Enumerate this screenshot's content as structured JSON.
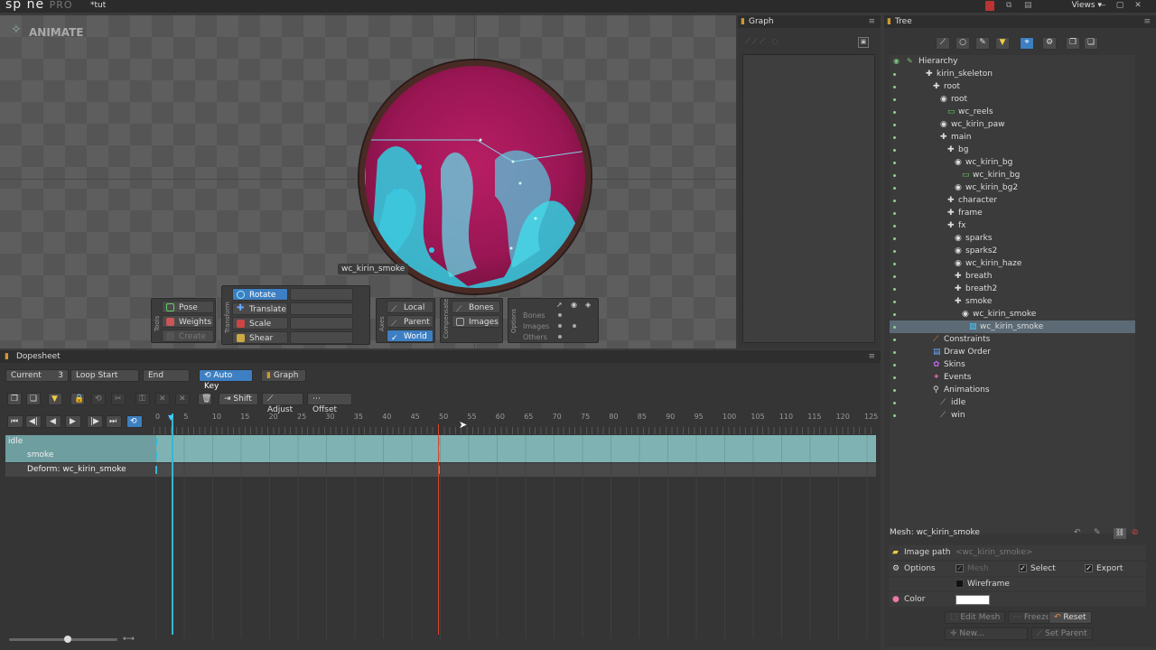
{
  "app": {
    "logo": "sp ne",
    "logo_suffix": "PRO",
    "document_title": "*tut",
    "views_label": "Views"
  },
  "viewport": {
    "mode_label": "ANIMATE",
    "bone_label": "wc_kirin_smoke"
  },
  "tools": {
    "group_label": "Tools",
    "pose": "Pose",
    "weights": "Weights",
    "create": "Create"
  },
  "transform": {
    "group_label": "Transform",
    "rotate": "Rotate",
    "translate": "Translate",
    "scale": "Scale",
    "shear": "Shear"
  },
  "axes": {
    "group_label": "Axes",
    "local": "Local",
    "parent": "Parent",
    "world": "World"
  },
  "compensate": {
    "group_label": "Compensate",
    "bones": "Bones",
    "images": "Images"
  },
  "options": {
    "group_label": "Options",
    "bones": "Bones",
    "images": "Images",
    "others": "Others"
  },
  "graph": {
    "title": "Graph"
  },
  "tree": {
    "title": "Tree",
    "hierarchy_label": "Hierarchy",
    "items": [
      {
        "label": "kirin_skeleton",
        "depth": 0,
        "icon": "skeleton-icon"
      },
      {
        "label": "root",
        "depth": 1,
        "icon": "bone-icon"
      },
      {
        "label": "root",
        "depth": 2,
        "icon": "slot-icon"
      },
      {
        "label": "wc_reels",
        "depth": 3,
        "icon": "image-icon"
      },
      {
        "label": "wc_kirin_paw",
        "depth": 2,
        "icon": "slot-icon"
      },
      {
        "label": "main",
        "depth": 2,
        "icon": "bone-icon"
      },
      {
        "label": "bg",
        "depth": 3,
        "icon": "bone-icon"
      },
      {
        "label": "wc_kirin_bg",
        "depth": 4,
        "icon": "slot-icon"
      },
      {
        "label": "wc_kirin_bg",
        "depth": 5,
        "icon": "image-icon"
      },
      {
        "label": "wc_kirin_bg2",
        "depth": 4,
        "icon": "slot-icon"
      },
      {
        "label": "character",
        "depth": 3,
        "icon": "bone-icon"
      },
      {
        "label": "frame",
        "depth": 3,
        "icon": "bone-icon"
      },
      {
        "label": "fx",
        "depth": 3,
        "icon": "bone-icon"
      },
      {
        "label": "sparks",
        "depth": 4,
        "icon": "slot-icon"
      },
      {
        "label": "sparks2",
        "depth": 4,
        "icon": "slot-icon"
      },
      {
        "label": "wc_kirin_haze",
        "depth": 4,
        "icon": "slot-icon"
      },
      {
        "label": "breath",
        "depth": 4,
        "icon": "bone-icon"
      },
      {
        "label": "breath2",
        "depth": 4,
        "icon": "bone-icon"
      },
      {
        "label": "smoke",
        "depth": 4,
        "icon": "bone-icon"
      },
      {
        "label": "wc_kirin_smoke",
        "depth": 5,
        "icon": "slot-icon"
      },
      {
        "label": "wc_kirin_smoke",
        "depth": 6,
        "icon": "mesh-icon",
        "selected": true
      },
      {
        "label": "Constraints",
        "depth": 1,
        "icon": "constraints-icon"
      },
      {
        "label": "Draw Order",
        "depth": 1,
        "icon": "draw-order-icon"
      },
      {
        "label": "Skins",
        "depth": 1,
        "icon": "skins-icon"
      },
      {
        "label": "Events",
        "depth": 1,
        "icon": "events-icon"
      },
      {
        "label": "Animations",
        "depth": 1,
        "icon": "animations-icon"
      },
      {
        "label": "idle",
        "depth": 2,
        "icon": "animation-icon"
      },
      {
        "label": "win",
        "depth": 2,
        "icon": "animation-icon"
      }
    ]
  },
  "inspector": {
    "title": "Mesh: wc_kirin_smoke",
    "image_path_label": "Image path",
    "image_path_value": "<wc_kirin_smoke>",
    "options_label": "Options",
    "mesh_label": "Mesh",
    "select_label": "Select",
    "export_label": "Export",
    "wireframe_label": "Wireframe",
    "color_label": "Color",
    "color_value": "#ffffff",
    "edit_mesh": "Edit Mesh",
    "freeze": "Freeze",
    "reset": "Reset",
    "new": "New...",
    "set_parent": "Set Parent"
  },
  "dopesheet": {
    "title": "Dopesheet",
    "current_label": "Current",
    "current_value": "3",
    "loop_start_label": "Loop Start",
    "end_label": "End",
    "auto_key": "Auto Key",
    "graph": "Graph",
    "shift": "Shift",
    "adjust": "Adjust",
    "offset": "Offset",
    "ruler_ticks": [
      "0",
      "5",
      "10",
      "15",
      "20",
      "25",
      "30",
      "35",
      "40",
      "45",
      "50",
      "55",
      "60",
      "65",
      "70",
      "75",
      "80",
      "85",
      "90",
      "95",
      "100",
      "105",
      "110",
      "115",
      "120",
      "125"
    ],
    "tracks": [
      {
        "label": "idle"
      },
      {
        "label": "smoke"
      },
      {
        "label": "Deform: wc_kirin_smoke"
      }
    ]
  },
  "colors": {
    "accent": "#3d7fc2",
    "track": "#7fb3b3",
    "playhead": "#36b6d4",
    "key_marker": "#e05a3a"
  }
}
